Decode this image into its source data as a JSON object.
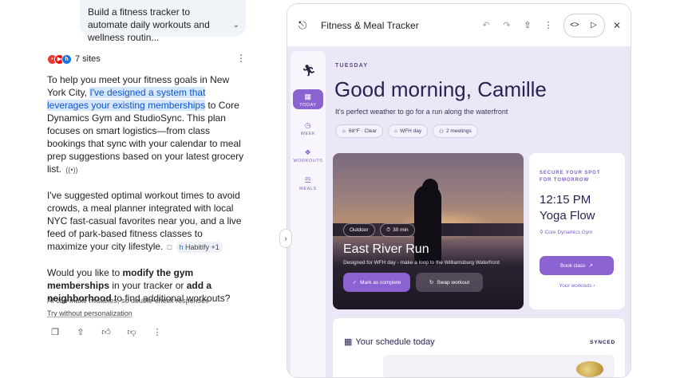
{
  "chat": {
    "user_prompt": "Build a fitness tracker to automate daily workouts and wellness routin...",
    "sources_label": "7 sites",
    "para1_a": "To help you meet your fitness goals in New York City, ",
    "para1_hl": "I've designed a system that leverages your existing memberships",
    "para1_b": " to Core Dynamics Gym and StudioSync. This plan focuses on smart logistics—from class bookings that sync with your calendar to meal prep suggestions based on your latest grocery list.",
    "para2": "I've suggested optimal workout times to avoid crowds, a meal planner integrated with local NYC fast-casual favorites near you, and a live feed of park-based fitness classes to maximize your city lifestyle.",
    "para2_source": "Habitify +1",
    "para3_a": "Would you like to ",
    "para3_b1": "modify the gym memberships",
    "para3_c": " in your tracker or ",
    "para3_b2": "add a neighborhood",
    "para3_d": " to find additional workouts?",
    "disclaimer": "AI can make mistakes, so double-check responses",
    "try_link": "Try without personalization"
  },
  "canvas": {
    "title": "Fitness & Meal Tracker"
  },
  "app": {
    "nav": [
      {
        "label": "TODAY",
        "icon": "calendar-icon"
      },
      {
        "label": "WEEK",
        "icon": "clock-icon"
      },
      {
        "label": "WORKOUTS",
        "icon": "dumbbell-icon"
      },
      {
        "label": "MEALS",
        "icon": "fork-icon"
      }
    ],
    "day": "TUESDAY",
    "greeting": "Good morning, Camille",
    "subtitle": "It's perfect weather to go for a run along the waterfront",
    "chips": [
      "68°F · Clear",
      "WFH day",
      "2 meetings"
    ],
    "hero": {
      "tag1": "Outdoor",
      "tag2": "30 min",
      "title": "East River Run",
      "desc": "Designed for WFH day - make a loop to the Williamsburg Waterfront",
      "primary": "Mark as complete",
      "secondary": "Swap workout"
    },
    "side": {
      "eyebrow1": "SECURE YOUR SPOT",
      "eyebrow2": "FOR TOMORROW",
      "time": "12:15 PM",
      "class": "Yoga Flow",
      "location": "Core Dynamics Gym",
      "button": "Book class",
      "link": "Your workouts"
    },
    "schedule": {
      "title": "Your schedule today",
      "status": "SYNCED"
    }
  },
  "colors": {
    "accent": "#8b63d1",
    "app_bg": "#ece7f7",
    "heading": "#2a2252",
    "highlight": "#d8e6fb"
  }
}
